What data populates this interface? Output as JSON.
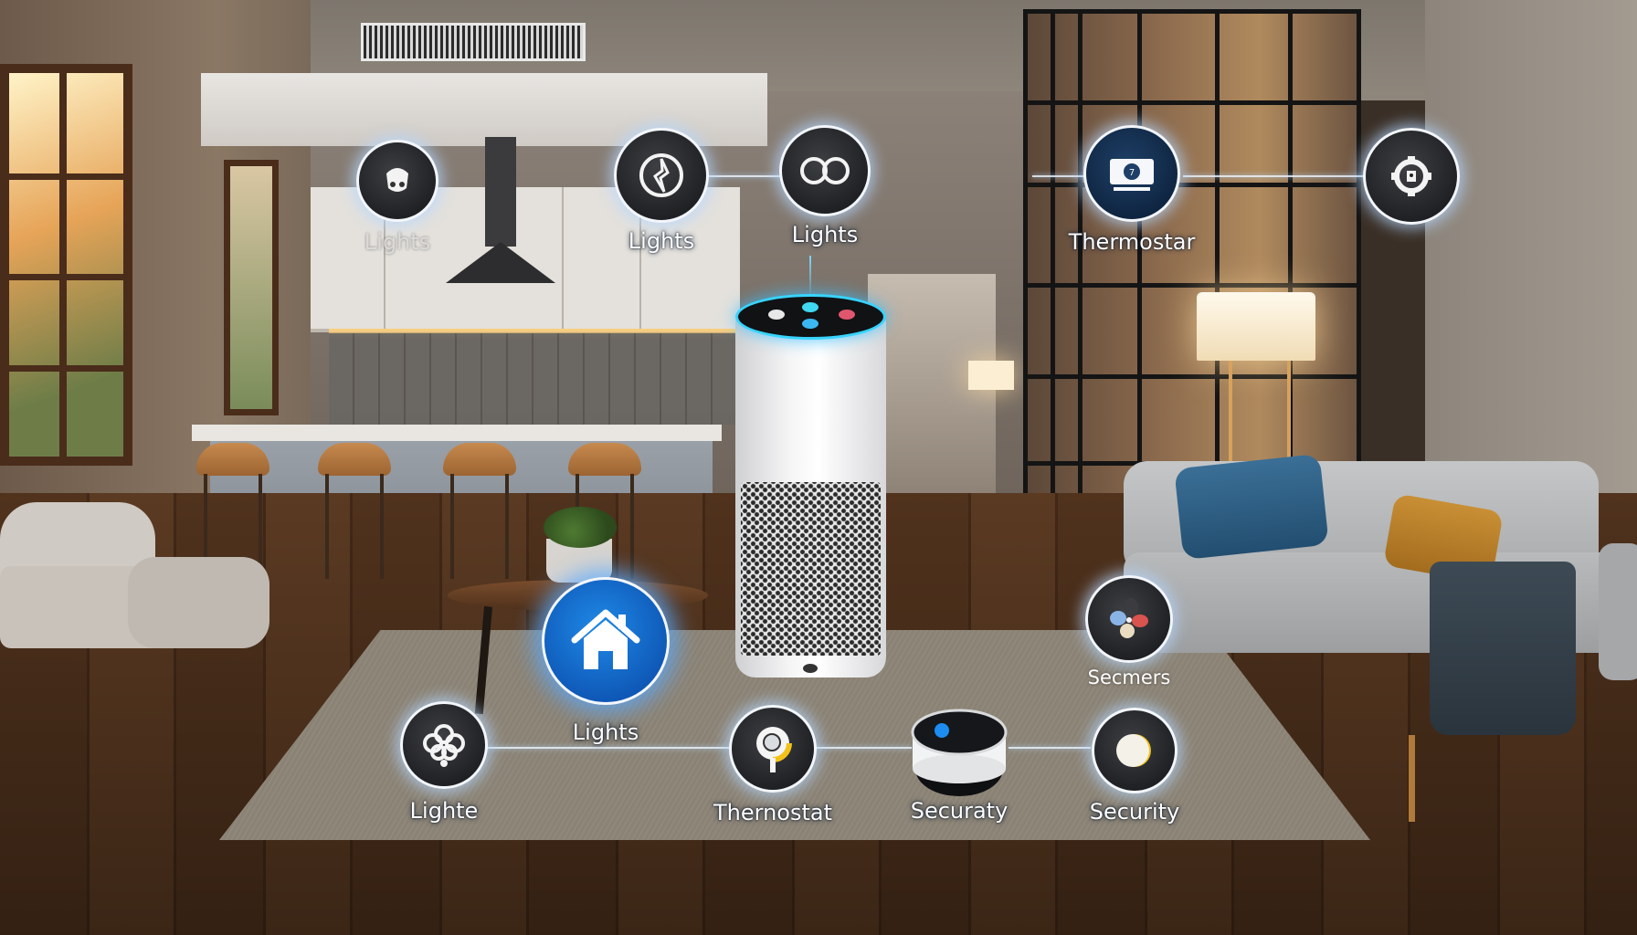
{
  "scene": {
    "title": "Smart home living room with voice assistant hub",
    "hub_device": {
      "name": "Smart speaker",
      "ring_color": "#37d4ff",
      "buttons": [
        {
          "icon": "mute-icon",
          "color": "#e8e8e8"
        },
        {
          "icon": "action-icon",
          "color": "#3fd8f0"
        },
        {
          "icon": "volume-icon",
          "color": "#e0566e"
        },
        {
          "icon": "listen-icon",
          "color": "#3bb8f2"
        }
      ]
    }
  },
  "nodes": {
    "top_1": {
      "label": "Lights",
      "icon": "lightbulb-icon"
    },
    "top_2": {
      "label": "Lights",
      "icon": "light-control-icon"
    },
    "top_3": {
      "label": "Lights",
      "icon": "infinity-icon"
    },
    "top_4": {
      "label": "Thermostar",
      "icon": "camera-icon"
    },
    "top_5": {
      "label": "",
      "icon": "lock-gear-icon"
    },
    "right_mid": {
      "label": "Secmers",
      "icon": "sensors-icon"
    },
    "home_hub": {
      "label": "Lights",
      "icon": "home-icon",
      "accent": "#1677d8"
    },
    "bottom_1": {
      "label": "Lighte",
      "icon": "flower-light-icon"
    },
    "bottom_2": {
      "label": "Thernostat",
      "icon": "thermostat-dial-icon",
      "accent": "#f2c21b"
    },
    "bottom_3": {
      "label": "Securaty",
      "icon": "echo-dot-icon",
      "accent": "#1d8cf0"
    },
    "bottom_4": {
      "label": "Security",
      "icon": "moon-sensor-icon",
      "accent": "#f2c21b"
    }
  }
}
